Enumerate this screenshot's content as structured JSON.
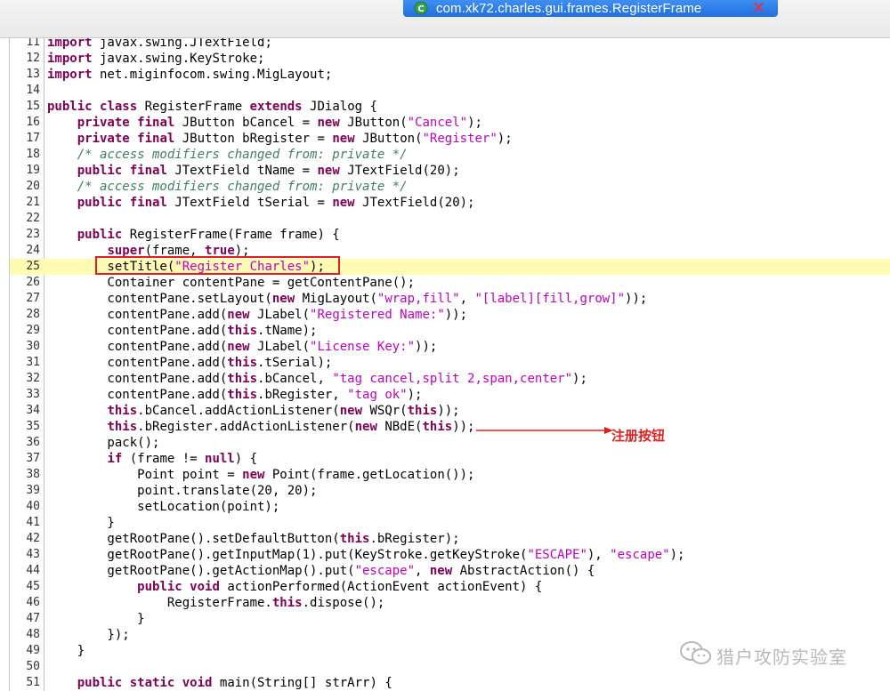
{
  "tab": {
    "title": "com.xk72.charles.gui.frames.RegisterFrame",
    "close_icon": "close-icon"
  },
  "annotation": {
    "label": "注册按钮"
  },
  "watermark": {
    "text": "猎户攻防实验室"
  },
  "colors": {
    "keyword": "#7f0055",
    "string": "#2a00ff",
    "comment": "#3f7f5f",
    "highlight": "#fffbb3",
    "annotation": "#e02020",
    "tab": "#2a7ee8"
  },
  "editor": {
    "current_line": 25,
    "lines": [
      {
        "n": "11",
        "text": "import javax.swing.JTextField;"
      },
      {
        "n": "12",
        "text": "import javax.swing.KeyStroke;"
      },
      {
        "n": "13",
        "text": "import net.miginfocom.swing.MigLayout;"
      },
      {
        "n": "14",
        "text": ""
      },
      {
        "n": "15",
        "text": "public class RegisterFrame extends JDialog {"
      },
      {
        "n": "16",
        "text": "    private final JButton bCancel = new JButton(\"Cancel\");"
      },
      {
        "n": "17",
        "text": "    private final JButton bRegister = new JButton(\"Register\");"
      },
      {
        "n": "18",
        "text": "    /* access modifiers changed from: private */"
      },
      {
        "n": "19",
        "text": "    public final JTextField tName = new JTextField(20);"
      },
      {
        "n": "20",
        "text": "    /* access modifiers changed from: private */"
      },
      {
        "n": "21",
        "text": "    public final JTextField tSerial = new JTextField(20);"
      },
      {
        "n": "22",
        "text": ""
      },
      {
        "n": "23",
        "text": "    public RegisterFrame(Frame frame) {"
      },
      {
        "n": "24",
        "text": "        super(frame, true);"
      },
      {
        "n": "25",
        "text": "        setTitle(\"Register Charles\");"
      },
      {
        "n": "26",
        "text": "        Container contentPane = getContentPane();"
      },
      {
        "n": "27",
        "text": "        contentPane.setLayout(new MigLayout(\"wrap,fill\", \"[label][fill,grow]\"));"
      },
      {
        "n": "28",
        "text": "        contentPane.add(new JLabel(\"Registered Name:\"));"
      },
      {
        "n": "29",
        "text": "        contentPane.add(this.tName);"
      },
      {
        "n": "30",
        "text": "        contentPane.add(new JLabel(\"License Key:\"));"
      },
      {
        "n": "31",
        "text": "        contentPane.add(this.tSerial);"
      },
      {
        "n": "32",
        "text": "        contentPane.add(this.bCancel, \"tag cancel,split 2,span,center\");"
      },
      {
        "n": "33",
        "text": "        contentPane.add(this.bRegister, \"tag ok\");"
      },
      {
        "n": "34",
        "text": "        this.bCancel.addActionListener(new WSQr(this));"
      },
      {
        "n": "35",
        "text": "        this.bRegister.addActionListener(new NBdE(this));"
      },
      {
        "n": "36",
        "text": "        pack();"
      },
      {
        "n": "37",
        "text": "        if (frame != null) {"
      },
      {
        "n": "38",
        "text": "            Point point = new Point(frame.getLocation());"
      },
      {
        "n": "39",
        "text": "            point.translate(20, 20);"
      },
      {
        "n": "40",
        "text": "            setLocation(point);"
      },
      {
        "n": "41",
        "text": "        }"
      },
      {
        "n": "42",
        "text": "        getRootPane().setDefaultButton(this.bRegister);"
      },
      {
        "n": "43",
        "text": "        getRootPane().getInputMap(1).put(KeyStroke.getKeyStroke(\"ESCAPE\"), \"escape\");"
      },
      {
        "n": "44",
        "text": "        getRootPane().getActionMap().put(\"escape\", new AbstractAction() {"
      },
      {
        "n": "45",
        "text": "            public void actionPerformed(ActionEvent actionEvent) {"
      },
      {
        "n": "46",
        "text": "                RegisterFrame.this.dispose();"
      },
      {
        "n": "47",
        "text": "            }"
      },
      {
        "n": "48",
        "text": "        });"
      },
      {
        "n": "49",
        "text": "    }"
      },
      {
        "n": "50",
        "text": ""
      },
      {
        "n": "51",
        "text": "    public static void main(String[] strArr) {"
      }
    ]
  }
}
